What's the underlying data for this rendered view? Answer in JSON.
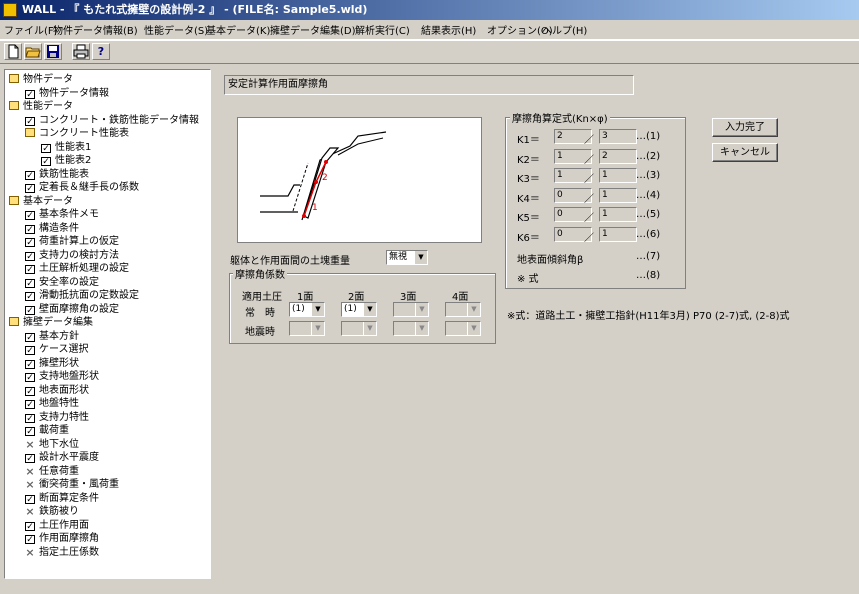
{
  "window": {
    "title": "WALL - 『 もたれ式擁壁の設計例-2 』 - (FILE名: Sample5.wld)"
  },
  "menu": [
    "ファイル(F)",
    "物件データ情報(B)",
    "性能データ(S)",
    "基本データ(K)",
    "擁壁データ編集(D)",
    "解析実行(C)",
    "結果表示(H)",
    "オプション(O)",
    "ヘルプ(H)"
  ],
  "toolbar": {
    "buttons": [
      "new-icon",
      "open-icon",
      "save-icon",
      "print-icon",
      "help-icon"
    ]
  },
  "tree": [
    {
      "label": "物件データ",
      "icon": "folder",
      "level": 0
    },
    {
      "label": "物件データ情報",
      "icon": "check",
      "level": 1
    },
    {
      "label": "性能データ",
      "icon": "folder",
      "level": 0
    },
    {
      "label": "コンクリート・鉄筋性能データ情報",
      "icon": "check",
      "level": 1
    },
    {
      "label": "コンクリート性能表",
      "icon": "folder",
      "level": 1
    },
    {
      "label": "性能表1",
      "icon": "check",
      "level": 2
    },
    {
      "label": "性能表2",
      "icon": "check",
      "level": 2
    },
    {
      "label": "鉄筋性能表",
      "icon": "check",
      "level": 1
    },
    {
      "label": "定着長＆継手長の係数",
      "icon": "check",
      "level": 1
    },
    {
      "label": "基本データ",
      "icon": "folder",
      "level": 0
    },
    {
      "label": "基本条件メモ",
      "icon": "check",
      "level": 1
    },
    {
      "label": "構造条件",
      "icon": "check",
      "level": 1
    },
    {
      "label": "荷重計算上の仮定",
      "icon": "check",
      "level": 1
    },
    {
      "label": "支持力の検討方法",
      "icon": "check",
      "level": 1
    },
    {
      "label": "土圧解析処理の設定",
      "icon": "check",
      "level": 1
    },
    {
      "label": "安全率の設定",
      "icon": "check",
      "level": 1
    },
    {
      "label": "滑動抵抗面の定数設定",
      "icon": "check",
      "level": 1
    },
    {
      "label": "壁面摩擦角の設定",
      "icon": "check",
      "level": 1
    },
    {
      "label": "擁壁データ編集",
      "icon": "folder",
      "level": 0
    },
    {
      "label": "基本方針",
      "icon": "check",
      "level": 1
    },
    {
      "label": "ケース選択",
      "icon": "check",
      "level": 1
    },
    {
      "label": "擁壁形状",
      "icon": "check",
      "level": 1
    },
    {
      "label": "支持地盤形状",
      "icon": "check",
      "level": 1
    },
    {
      "label": "地表面形状",
      "icon": "check",
      "level": 1
    },
    {
      "label": "地盤特性",
      "icon": "check",
      "level": 1
    },
    {
      "label": "支持力特性",
      "icon": "check",
      "level": 1
    },
    {
      "label": "載荷重",
      "icon": "check",
      "level": 1
    },
    {
      "label": "地下水位",
      "icon": "cross",
      "level": 1
    },
    {
      "label": "設計水平震度",
      "icon": "check",
      "level": 1
    },
    {
      "label": "任意荷重",
      "icon": "cross",
      "level": 1
    },
    {
      "label": "衝突荷重・風荷重",
      "icon": "cross",
      "level": 1
    },
    {
      "label": "断面算定条件",
      "icon": "check",
      "level": 1
    },
    {
      "label": "鉄筋被り",
      "icon": "cross",
      "level": 1
    },
    {
      "label": "土圧作用面",
      "icon": "check",
      "level": 1
    },
    {
      "label": "作用面摩擦角",
      "icon": "check",
      "level": 1
    },
    {
      "label": "指定土圧係数",
      "icon": "cross",
      "level": 1
    }
  ],
  "main": {
    "heading": "安定計算作用面摩擦角",
    "diagram": {
      "label1": "1",
      "label2": "2"
    },
    "soil_weight_label": "躯体と作用面間の土塊重量",
    "soil_weight_value": "無視",
    "coef_group": {
      "title": "摩擦角係数",
      "col_header": "適用土圧",
      "faces": [
        "1面",
        "2面",
        "3面",
        "4面"
      ],
      "rows": [
        {
          "label": "常　時",
          "values": [
            "(1)",
            "(1)",
            "",
            ""
          ],
          "enabled": [
            true,
            true,
            false,
            false
          ]
        },
        {
          "label": "地震時",
          "values": [
            "",
            "",
            "",
            ""
          ],
          "enabled": [
            false,
            false,
            false,
            false
          ]
        }
      ]
    },
    "formula_group": {
      "title": "摩擦角算定式(Kn×φ)",
      "rows": [
        {
          "label": "K1＝",
          "num": "2",
          "den": "3",
          "ref": "…(1)"
        },
        {
          "label": "K2＝",
          "num": "1",
          "den": "2",
          "ref": "…(2)"
        },
        {
          "label": "K3＝",
          "num": "1",
          "den": "1",
          "ref": "…(3)"
        },
        {
          "label": "K4＝",
          "num": "0",
          "den": "1",
          "ref": "…(4)"
        },
        {
          "label": "K5＝",
          "num": "0",
          "den": "1",
          "ref": "…(5)"
        },
        {
          "label": "K6＝",
          "num": "0",
          "den": "1",
          "ref": "…(6)"
        }
      ],
      "slash": "／",
      "extra": [
        {
          "label": "地表面傾斜角β",
          "ref": "…(7)"
        },
        {
          "label": "※ 式",
          "ref": "…(8)"
        }
      ]
    },
    "note": "※式：道路土工・擁壁工指針(H11年3月) P70 (2-7)式, (2-8)式",
    "buttons": {
      "done": "入力完了",
      "cancel": "キャンセル"
    }
  }
}
